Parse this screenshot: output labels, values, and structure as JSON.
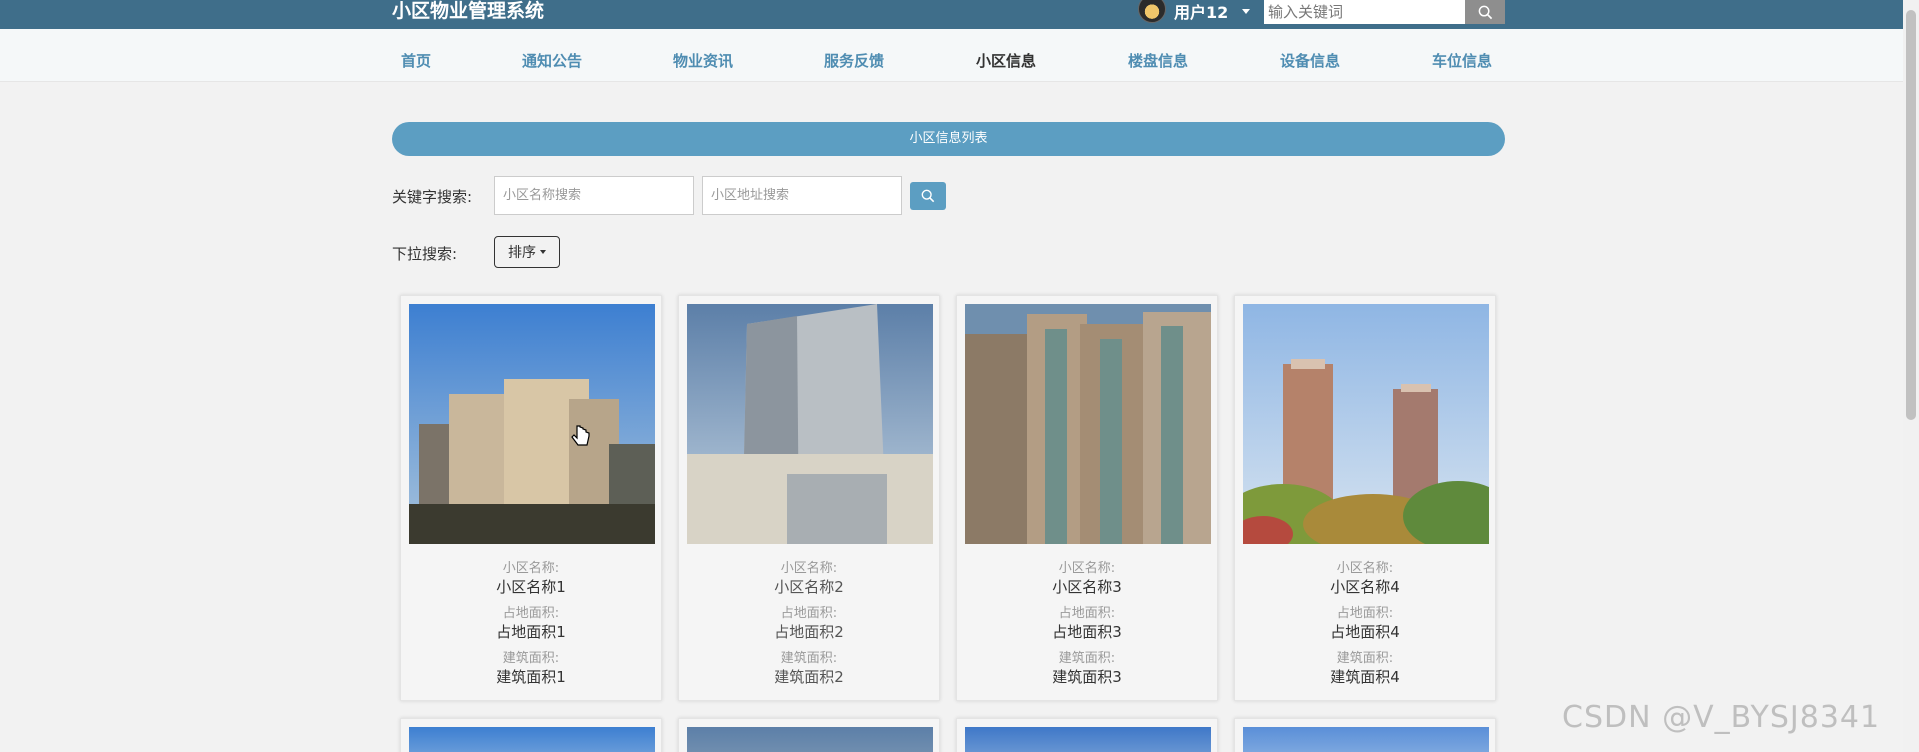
{
  "header": {
    "title": "小区物业管理系统",
    "user": "用户12",
    "search_placeholder": "输入关键词"
  },
  "nav": {
    "items": [
      {
        "label": "首页",
        "active": false
      },
      {
        "label": "通知公告",
        "active": false
      },
      {
        "label": "物业资讯",
        "active": false
      },
      {
        "label": "服务反馈",
        "active": false
      },
      {
        "label": "小区信息",
        "active": true
      },
      {
        "label": "楼盘信息",
        "active": false
      },
      {
        "label": "设备信息",
        "active": false
      },
      {
        "label": "车位信息",
        "active": false
      }
    ]
  },
  "main": {
    "list_title": "小区信息列表",
    "keyword_label": "关键字搜索:",
    "name_placeholder": "小区名称搜索",
    "address_placeholder": "小区地址搜索",
    "dropdown_label": "下拉搜索:",
    "sort_label": "排序"
  },
  "cards": [
    {
      "name_key": "小区名称:",
      "name": "小区名称1",
      "land_key": "占地面积:",
      "land": "占地面积1",
      "build_key": "建筑面积:",
      "build": "建筑面积1"
    },
    {
      "name_key": "小区名称:",
      "name": "小区名称2",
      "land_key": "占地面积:",
      "land": "占地面积2",
      "build_key": "建筑面积:",
      "build": "建筑面积2"
    },
    {
      "name_key": "小区名称:",
      "name": "小区名称3",
      "land_key": "占地面积:",
      "land": "占地面积3",
      "build_key": "建筑面积:",
      "build": "建筑面积3"
    },
    {
      "name_key": "小区名称:",
      "name": "小区名称4",
      "land_key": "占地面积:",
      "land": "占地面积4",
      "build_key": "建筑面积:",
      "build": "建筑面积4"
    }
  ],
  "watermark": "CSDN @V_BYSJ8341",
  "colors": {
    "header_bg": "#3f6e8a",
    "accent": "#5c9ec2",
    "nav_link": "#4f8db2"
  }
}
